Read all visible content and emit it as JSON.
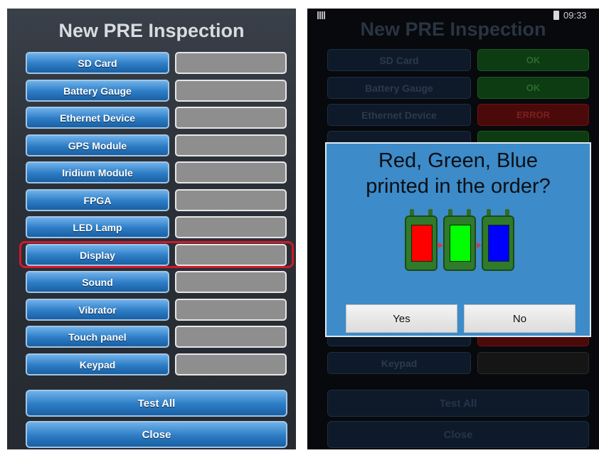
{
  "left": {
    "title": "New PRE Inspection",
    "items": [
      {
        "label": "SD Card"
      },
      {
        "label": "Battery Gauge"
      },
      {
        "label": "Ethernet Device"
      },
      {
        "label": "GPS Module"
      },
      {
        "label": "Iridium Module"
      },
      {
        "label": "FPGA"
      },
      {
        "label": "LED Lamp"
      },
      {
        "label": "Display"
      },
      {
        "label": "Sound"
      },
      {
        "label": "Vibrator"
      },
      {
        "label": "Touch panel"
      },
      {
        "label": "Keypad"
      }
    ],
    "highlighted_item": "Display",
    "test_all_label": "Test All",
    "close_label": "Close"
  },
  "right": {
    "status_bar": {
      "time": "09:33"
    },
    "title": "New PRE Inspection",
    "items": [
      {
        "label": "SD Card",
        "result": "OK",
        "status": "ok"
      },
      {
        "label": "Battery Gauge",
        "result": "OK",
        "status": "ok"
      },
      {
        "label": "Ethernet Device",
        "result": "ERROR",
        "status": "error"
      },
      {
        "label": "",
        "result": "",
        "status": "ok"
      },
      {
        "label": "Keypad",
        "result": "",
        "status": "none"
      }
    ],
    "test_all_label": "Test All",
    "close_label": "Close",
    "dialog": {
      "question": "Red, Green, Blue\nprinted in the order?",
      "device_screen_colors": [
        "#ff0000",
        "#00ff00",
        "#0000ff"
      ],
      "yes_label": "Yes",
      "no_label": "No"
    }
  },
  "colors": {
    "button_blue": "#2c7cc5",
    "result_gray": "#8e8e8e",
    "highlight_red": "#d0192a",
    "dialog_blue": "#3d8bc9",
    "ok_green": "#0d3b12",
    "error_red": "#4a0a0a"
  }
}
